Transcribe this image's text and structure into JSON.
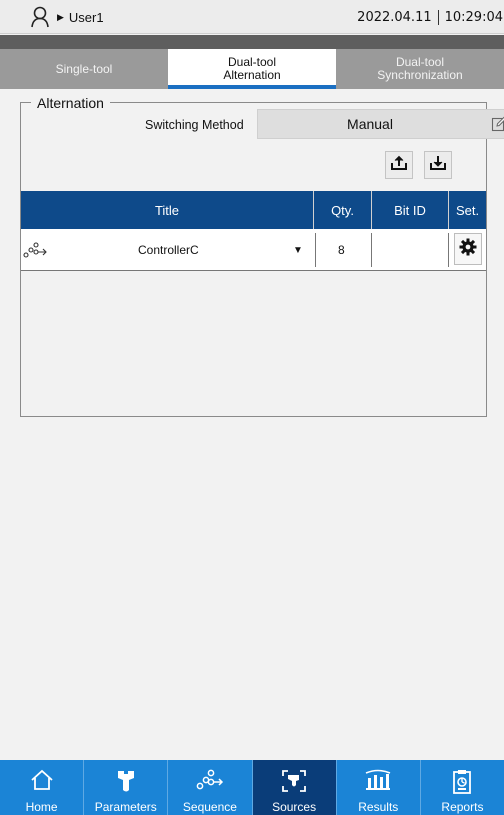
{
  "status": {
    "user": "User1",
    "date": "2022.04.11",
    "time": "10:29:04"
  },
  "tabs": [
    {
      "line1": "Single-tool",
      "line2": ""
    },
    {
      "line1": "Dual-tool",
      "line2": "Alternation"
    },
    {
      "line1": "Dual-tool",
      "line2": "Synchronization"
    }
  ],
  "active_tab": 1,
  "alternation": {
    "legend": "Alternation",
    "switching_label": "Switching Method",
    "switching_value": "Manual"
  },
  "table": {
    "headers": [
      "Title",
      "Qty.",
      "Bit ID",
      "Set."
    ],
    "rows": [
      {
        "title": "ControllerC",
        "qty": "8",
        "bit_id": ""
      }
    ]
  },
  "nav": [
    {
      "label": "Home",
      "icon": "home-icon"
    },
    {
      "label": "Parameters",
      "icon": "wrench-icon"
    },
    {
      "label": "Sequence",
      "icon": "sequence-icon"
    },
    {
      "label": "Sources",
      "icon": "sources-icon"
    },
    {
      "label": "Results",
      "icon": "results-icon"
    },
    {
      "label": "Reports",
      "icon": "reports-icon"
    }
  ],
  "active_nav": 3,
  "colors": {
    "header_blue": "#0e4a8a",
    "nav_blue": "#1b84d6",
    "nav_active": "#0a3d79",
    "tab_active_underline": "#1a6fc2"
  }
}
